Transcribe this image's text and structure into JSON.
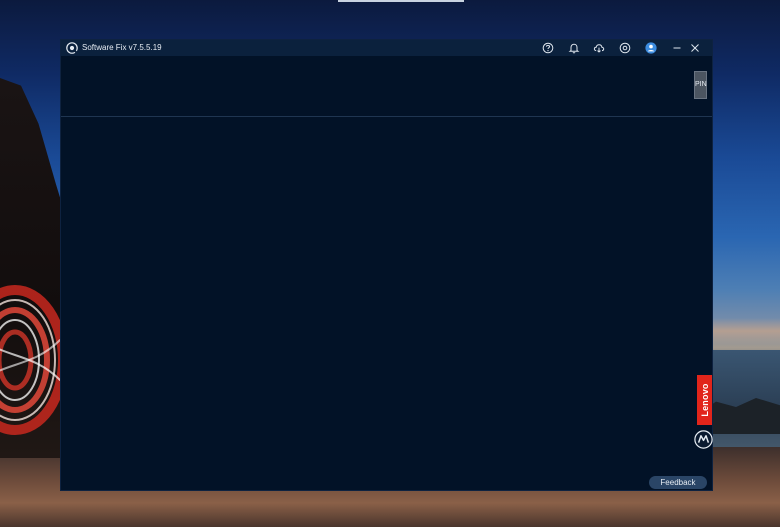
{
  "window": {
    "title": "Software Fix v7.5.5.19",
    "pin_label": "PIN",
    "feedback_label": "Feedback",
    "brand_label": "Lenovo"
  },
  "titlebar_icons": [
    "help-icon",
    "bell-icon",
    "cloud-download-icon",
    "settings-icon",
    "account-icon"
  ],
  "window_controls": [
    "minimize-icon",
    "close-icon"
  ],
  "colors": {
    "window_bg": "#021227",
    "titlebar_bg": "#0b213d",
    "lenovo_red": "#e1251b",
    "feedback_bg": "#2a4566",
    "account_blue": "#3c8ce0"
  }
}
